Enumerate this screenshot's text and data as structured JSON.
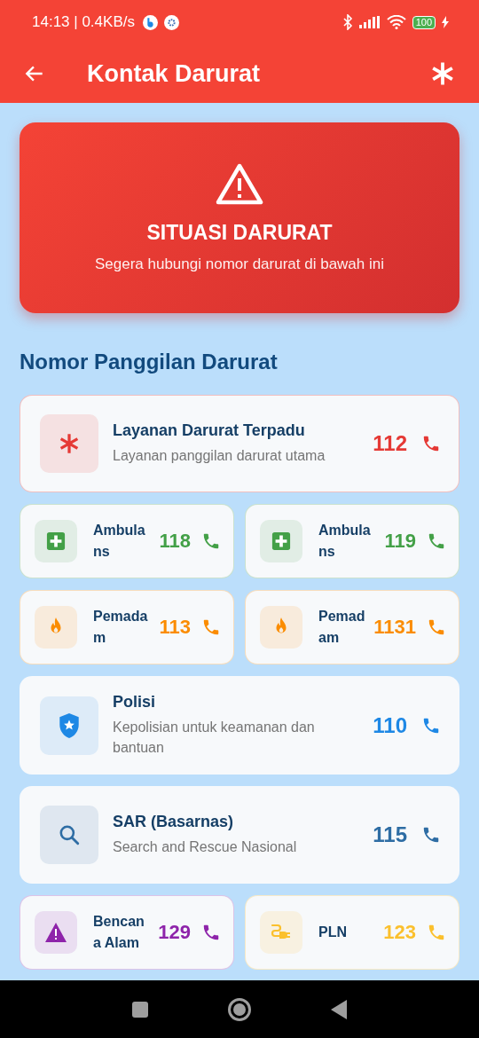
{
  "status_bar": {
    "time": "14:13 | 0.4KB/s",
    "battery": "100"
  },
  "app_bar": {
    "title": "Kontak Darurat"
  },
  "banner": {
    "title": "SITUASI DARURAT",
    "subtitle": "Segera hubungi nomor darurat di bawah ini"
  },
  "section_title": "Nomor Panggilan Darurat",
  "rows": [
    {
      "kind": "wide",
      "cards": [
        {
          "name": "Layanan Darurat Terpadu",
          "description": "Layanan panggilan darurat utama",
          "number": "112",
          "color": "#e53935"
        }
      ]
    },
    {
      "kind": "pair",
      "cards": [
        {
          "name": "Ambulans",
          "number": "118",
          "color": "#43a047"
        },
        {
          "name": "Ambulans",
          "number": "119",
          "color": "#43a047"
        }
      ]
    },
    {
      "kind": "pair",
      "cards": [
        {
          "name": "Pemadam",
          "number": "113",
          "color": "#fb8c00"
        },
        {
          "name": "Pemadam",
          "number": "1131",
          "color": "#fb8c00"
        }
      ]
    },
    {
      "kind": "wide",
      "cards": [
        {
          "name": "Polisi",
          "description": "Kepolisian untuk keamanan dan bantuan",
          "number": "110",
          "color": "#1e88e5"
        }
      ]
    },
    {
      "kind": "wide",
      "cards": [
        {
          "name": "SAR (Basarnas)",
          "description": "Search and Rescue Nasional",
          "number": "115",
          "color": "#2e6da4"
        }
      ]
    },
    {
      "kind": "pair",
      "cards": [
        {
          "name": "Bencana Alam",
          "number": "129",
          "color": "#8e24aa"
        },
        {
          "name": "PLN",
          "number": "123",
          "color": "#fbc02d"
        }
      ]
    }
  ]
}
